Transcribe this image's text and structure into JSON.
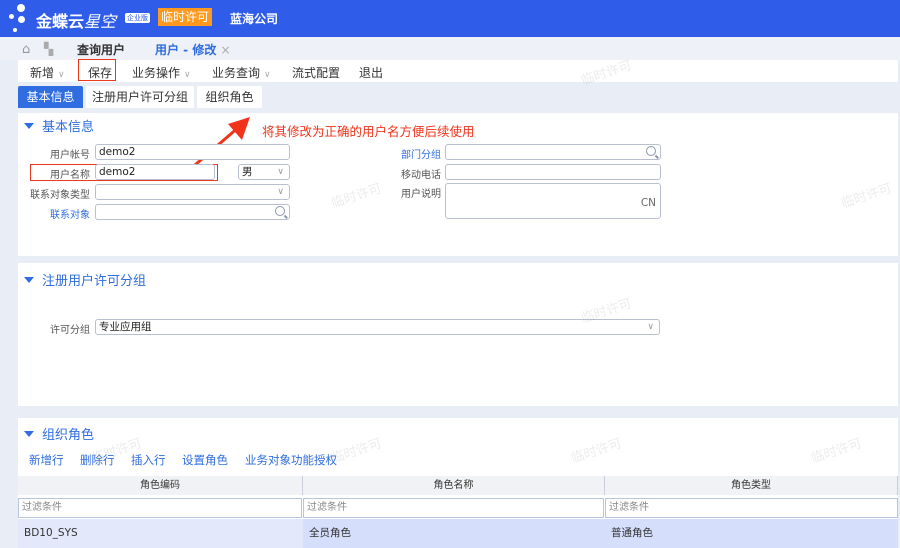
{
  "header": {
    "brand": "金蝶云",
    "brand_sub": "星空",
    "edition": "企业版",
    "license_badge": "临时许可",
    "company": "蓝海公司"
  },
  "tabs": [
    {
      "label": "查询用户"
    },
    {
      "label": "用户 - 修改",
      "close": "×"
    }
  ],
  "toolbar": {
    "new": "新增",
    "save": "保存",
    "biz_ops": "业务操作",
    "biz_query": "业务查询",
    "flow_config": "流式配置",
    "exit": "退出"
  },
  "subtabs": [
    "基本信息",
    "注册用户许可分组",
    "组织角色"
  ],
  "basic": {
    "title": "基本信息",
    "annotation": "将其修改为正确的用户名方便后续使用",
    "fields": {
      "account_label": "用户帐号",
      "account_value": "demo2",
      "name_label": "用户名称",
      "name_value": "demo2",
      "gender_value": "男",
      "contact_type_label": "联系对象类型",
      "contact_label": "联系对象",
      "dept_label": "部门分组",
      "mobile_label": "移动电话",
      "desc_label": "用户说明",
      "desc_lang": "CN"
    }
  },
  "license": {
    "title": "注册用户许可分组",
    "group_label": "许可分组",
    "group_value": "专业应用组"
  },
  "roles": {
    "title": "组织角色",
    "actions": [
      "新增行",
      "删除行",
      "插入行",
      "设置角色",
      "业务对象功能授权"
    ],
    "columns": [
      "角色编码",
      "角色名称",
      "角色类型"
    ],
    "filter_placeholder": "过滤条件",
    "rows": [
      [
        "BD10_SYS",
        "全员角色",
        "普通角色"
      ]
    ]
  },
  "watermark": "临时许可",
  "colors": {
    "brand": "#2f5ce9",
    "accent": "#2f6de0",
    "badge": "#ff9a1f",
    "annotation": "#f0331c"
  }
}
